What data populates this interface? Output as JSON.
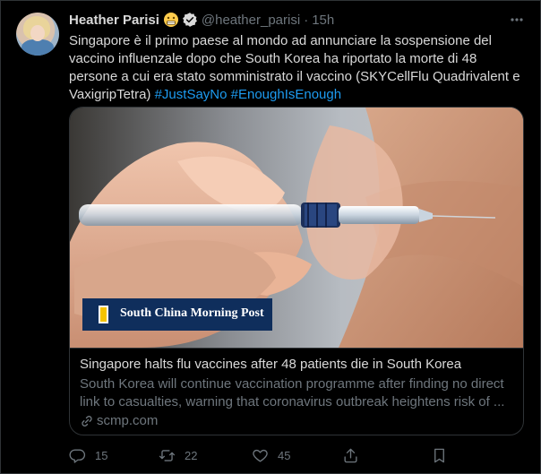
{
  "tweet": {
    "author_name": "Heather Parisi",
    "emoji": "grimacing-face",
    "verified": true,
    "handle": "@heather_parisi",
    "separator": "·",
    "time": "15h",
    "text_main": "Singapore è il primo paese al mondo ad annunciare la sospensione del vaccino influenzale dopo che South Korea ha riportato la morte di 48 persone a cui era stato somministrato il vaccino (SKYCellFlu Quadrivalent e VaxigripTetra) ",
    "hashtags": [
      "#JustSayNo",
      "#EnoughIsEnough"
    ]
  },
  "card": {
    "image": "syringe-injection-photo",
    "logo_text": "South China Morning Post",
    "title": "Singapore halts flu vaccines after 48 patients die in South Korea",
    "description": "South Korea will continue vaccination programme after finding no direct link to casualties, warning that coronavirus outbreak heightens risk of ...",
    "domain": "scmp.com"
  },
  "actions": {
    "reply_count": "15",
    "retweet_count": "22",
    "like_count": "45"
  },
  "colors": {
    "background": "#000000",
    "text": "#d9d9d9",
    "secondary": "#6e767d",
    "accent": "#1d9bf0",
    "border": "#2f3336",
    "scmp_blue": "#0f2e5c"
  }
}
